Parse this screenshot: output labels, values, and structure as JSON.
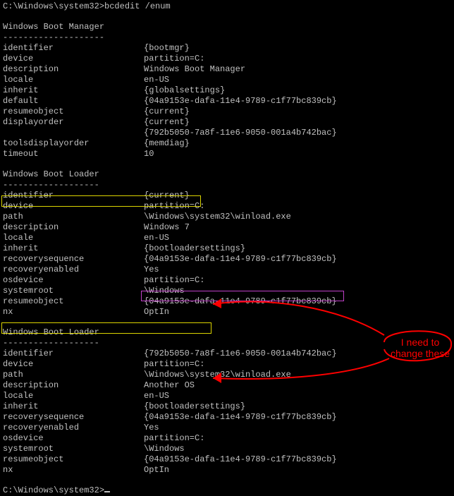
{
  "prompt1": "C:\\Windows\\system32>bcdedit /enum",
  "prompt2": "C:\\Windows\\system32>",
  "sections": {
    "bootmgr": {
      "title": "Windows Boot Manager",
      "underline": "--------------------",
      "rows": [
        {
          "k": "identifier",
          "v": "{bootmgr}"
        },
        {
          "k": "device",
          "v": "partition=C:"
        },
        {
          "k": "description",
          "v": "Windows Boot Manager"
        },
        {
          "k": "locale",
          "v": "en-US"
        },
        {
          "k": "inherit",
          "v": "{globalsettings}"
        },
        {
          "k": "default",
          "v": "{04a9153e-dafa-11e4-9789-c1f77bc839cb}"
        },
        {
          "k": "resumeobject",
          "v": "{current}"
        },
        {
          "k": "displayorder",
          "v": "{current}"
        },
        {
          "k": "",
          "v": "{792b5050-7a8f-11e6-9050-001a4b742bac}"
        },
        {
          "k": "toolsdisplayorder",
          "v": "{memdiag}"
        },
        {
          "k": "timeout",
          "v": "10"
        }
      ]
    },
    "loader1": {
      "title": "Windows Boot Loader",
      "underline": "-------------------",
      "rows": [
        {
          "k": "identifier",
          "v": "{current}"
        },
        {
          "k": "device",
          "v": "partition=C:"
        },
        {
          "k": "path",
          "v": "\\Windows\\system32\\winload.exe"
        },
        {
          "k": "description",
          "v": "Windows 7"
        },
        {
          "k": "locale",
          "v": "en-US"
        },
        {
          "k": "inherit",
          "v": "{bootloadersettings}"
        },
        {
          "k": "recoverysequence",
          "v": "{04a9153e-dafa-11e4-9789-c1f77bc839cb}"
        },
        {
          "k": "recoveryenabled",
          "v": "Yes"
        },
        {
          "k": "osdevice",
          "v": "partition=C:"
        },
        {
          "k": "systemroot",
          "v": "\\Windows"
        },
        {
          "k": "resumeobject",
          "v": "{04a9153e-dafa-11e4-9789-c1f77bc839cb}"
        },
        {
          "k": "nx",
          "v": "OptIn"
        }
      ]
    },
    "loader2": {
      "title": "Windows Boot Loader",
      "underline": "-------------------",
      "rows": [
        {
          "k": "identifier",
          "v": "{792b5050-7a8f-11e6-9050-001a4b742bac}"
        },
        {
          "k": "device",
          "v": "partition=C:"
        },
        {
          "k": "path",
          "v": "\\Windows\\system32\\winload.exe"
        },
        {
          "k": "description",
          "v": "Another OS"
        },
        {
          "k": "locale",
          "v": "en-US"
        },
        {
          "k": "inherit",
          "v": "{bootloadersettings}"
        },
        {
          "k": "recoverysequence",
          "v": "{04a9153e-dafa-11e4-9789-c1f77bc839cb}"
        },
        {
          "k": "recoveryenabled",
          "v": "Yes"
        },
        {
          "k": "osdevice",
          "v": "partition=C:"
        },
        {
          "k": "systemroot",
          "v": "\\Windows"
        },
        {
          "k": "resumeobject",
          "v": "{04a9153e-dafa-11e4-9789-c1f77bc839cb}"
        },
        {
          "k": "nx",
          "v": "OptIn"
        }
      ]
    }
  },
  "annotation": {
    "text1": "I need to",
    "text2": "change these"
  }
}
